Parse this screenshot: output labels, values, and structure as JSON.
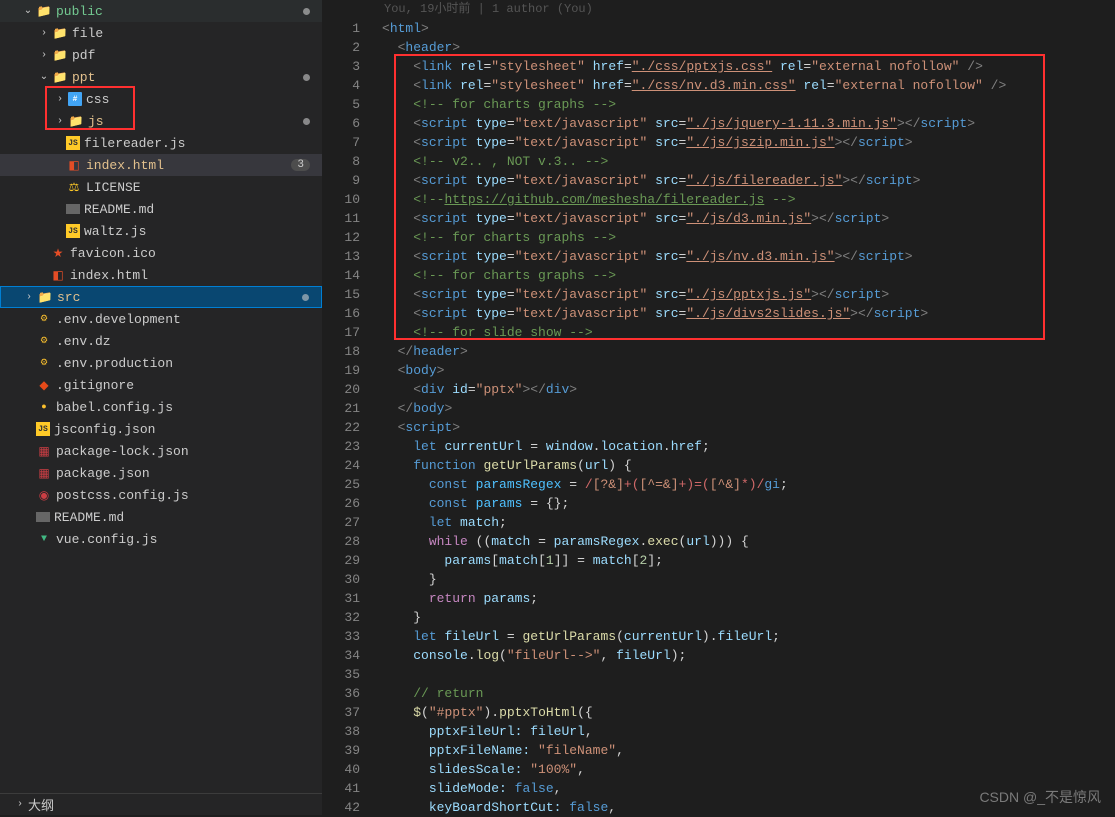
{
  "tree": {
    "public": "public",
    "file": "file",
    "pdf": "pdf",
    "ppt": "ppt",
    "css": "css",
    "js": "js",
    "filereader": "filereader.js",
    "indexhtml": "index.html",
    "indexbadge": "3",
    "license": "LICENSE",
    "readme": "README.md",
    "waltz": "waltz.js",
    "favicon": "favicon.ico",
    "indexhtml2": "index.html",
    "src": "src",
    "envdev": ".env.development",
    "envdz": ".env.dz",
    "envprod": ".env.production",
    "gitignore": ".gitignore",
    "babel": "babel.config.js",
    "jsconfig": "jsconfig.json",
    "pkglock": "package-lock.json",
    "pkg": "package.json",
    "postcss": "postcss.config.js",
    "readme2": "README.md",
    "vueconfig": "vue.config.js",
    "outline": "大纲"
  },
  "blame": "You, 19小时前 | 1 author (You)",
  "lines": {
    "1": "1",
    "2": "2",
    "3": "3",
    "4": "4",
    "5": "5",
    "6": "6",
    "7": "7",
    "8": "8",
    "9": "9",
    "10": "10",
    "11": "11",
    "12": "12",
    "13": "13",
    "14": "14",
    "15": "15",
    "16": "16",
    "17": "17",
    "18": "18",
    "19": "19",
    "20": "20",
    "21": "21",
    "22": "22",
    "23": "23",
    "24": "24",
    "25": "25",
    "26": "26",
    "27": "27",
    "28": "28",
    "29": "29",
    "30": "30",
    "31": "31",
    "32": "32",
    "33": "33",
    "34": "34",
    "35": "35",
    "36": "36",
    "37": "37",
    "38": "38",
    "39": "39",
    "40": "40",
    "41": "41",
    "42": "42"
  },
  "code": {
    "html": "html",
    "header": "header",
    "link": "link",
    "rel": "rel",
    "stylesheet": "\"stylesheet\"",
    "href": "href",
    "css1": "\"./css/pptxjs.css\"",
    "css2": "\"./css/nv.d3.min.css\"",
    "extnofollow": "\"external nofollow\"",
    "slash": "/>",
    "charts_c": "<!-- for charts graphs -->",
    "script": "script",
    "type": "type",
    "textjs": "\"text/javascript\"",
    "src": "src",
    "jquery": "\"./js/jquery-1.11.3.min.js\"",
    "jszip": "\"./js/jszip.min.js\"",
    "v2c": "<!-- v2.. , NOT v.3.. -->",
    "filereader": "\"./js/filereader.js\"",
    "github_c": "<!--https://github.com/meshesha/filereader.js -->",
    "d3": "\"./js/d3.min.js\"",
    "nvd3": "\"./js/nv.d3.min.js\"",
    "pptxjs": "\"./js/pptxjs.js\"",
    "divs2": "\"./js/divs2slides.js\"",
    "slide_c": "<!-- for slide show -->",
    "body": "body",
    "div": "div",
    "id": "id",
    "pptx": "\"pptx\"",
    "let": "let",
    "currentUrl": "currentUrl",
    "eq": " = ",
    "windowloc": "window.location.href;",
    "function": "function",
    "getUrlParams": "getUrlParams",
    "url": "url",
    "const": "const",
    "paramsRegex": "paramsRegex",
    "regex": "/[?&]+([^=&]+)=([^&]*)/gi",
    "semi": ";",
    "params": "params",
    "empty": "{}",
    "match": "match",
    "while": "while",
    "exec": ".exec(",
    "n1": "1",
    "n2": "2",
    "return": "return",
    "fileUrl": "fileUrl",
    "dotfileUrl": ".fileUrl;",
    "console": "console",
    "log": "log",
    "fileurlstr": "\"fileUrl-->\"",
    "returnc": "// return",
    "dollar": "$",
    "pptxsel": "\"#pptx\"",
    "pptxToHtml": "pptxToHtml",
    "pptxFileUrl": "pptxFileUrl:",
    "pptxFileName": "pptxFileName:",
    "fileName": "\"fileName\"",
    "slidesScale": "slidesScale:",
    "hundred": "\"100%\"",
    "slideMode": "slideMode:",
    "false": "false",
    "keyBoardShortCut": "keyBoardShortCut:"
  },
  "watermark": "CSDN @_不是惊风"
}
